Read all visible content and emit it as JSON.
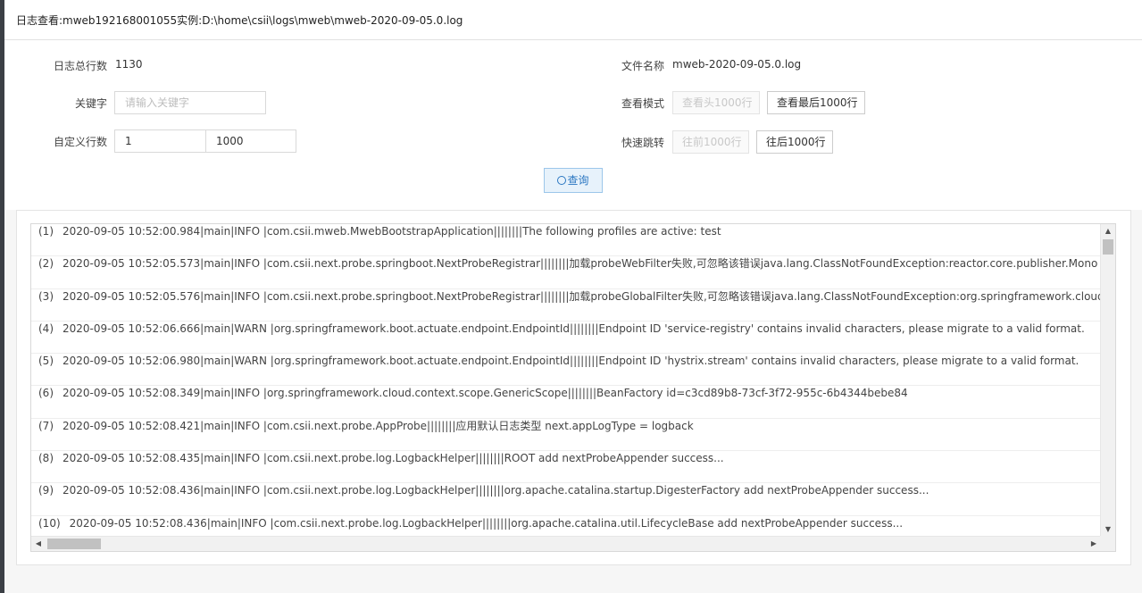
{
  "window": {
    "title": "日志查看:mweb192168001055实例:D:\\home\\csii\\logs\\mweb\\mweb-2020-09-05.0.log"
  },
  "form": {
    "total_lines_label": "日志总行数",
    "total_lines_value": "1130",
    "file_name_label": "文件名称",
    "file_name_value": "mweb-2020-09-05.0.log",
    "keyword_label": "关键字",
    "keyword_placeholder": "请输入关键字",
    "view_mode_label": "查看模式",
    "view_head_button": "查看头1000行",
    "view_tail_button": "查看最后1000行",
    "custom_lines_label": "自定义行数",
    "custom_start_value": "1",
    "custom_end_value": "1000",
    "quick_jump_label": "快速跳转",
    "prev_button": "往前1000行",
    "next_button": "往后1000行",
    "query_button": "查询",
    "query_icon": "search-icon"
  },
  "log": {
    "rows": [
      {
        "num": "(1)",
        "text": "2020-09-05 10:52:00.984|main|INFO |com.csii.mweb.MwebBootstrapApplication||||||||The following profiles are active: test"
      },
      {
        "num": "(2)",
        "text": "2020-09-05 10:52:05.573|main|INFO |com.csii.next.probe.springboot.NextProbeRegistrar||||||||加载probeWebFilter失败,可忽略该错误java.lang.ClassNotFoundException:reactor.core.publisher.Mono"
      },
      {
        "num": "(3)",
        "text": "2020-09-05 10:52:05.576|main|INFO |com.csii.next.probe.springboot.NextProbeRegistrar||||||||加载probeGlobalFilter失败,可忽略该错误java.lang.ClassNotFoundException:org.springframework.cloud.gateway.filter.GlobalF"
      },
      {
        "num": "(4)",
        "text": "2020-09-05 10:52:06.666|main|WARN |org.springframework.boot.actuate.endpoint.EndpointId||||||||Endpoint ID 'service-registry' contains invalid characters, please migrate to a valid format."
      },
      {
        "num": "(5)",
        "text": "2020-09-05 10:52:06.980|main|WARN |org.springframework.boot.actuate.endpoint.EndpointId||||||||Endpoint ID 'hystrix.stream' contains invalid characters, please migrate to a valid format."
      },
      {
        "num": "(6)",
        "text": "2020-09-05 10:52:08.349|main|INFO |org.springframework.cloud.context.scope.GenericScope||||||||BeanFactory id=c3cd89b8-73cf-3f72-955c-6b4344bebe84"
      },
      {
        "num": "(7)",
        "text": "2020-09-05 10:52:08.421|main|INFO |com.csii.next.probe.AppProbe||||||||应用默认日志类型 next.appLogType = logback"
      },
      {
        "num": "(8)",
        "text": "2020-09-05 10:52:08.435|main|INFO |com.csii.next.probe.log.LogbackHelper||||||||ROOT add nextProbeAppender success..."
      },
      {
        "num": "(9)",
        "text": "2020-09-05 10:52:08.436|main|INFO |com.csii.next.probe.log.LogbackHelper||||||||org.apache.catalina.startup.DigesterFactory add nextProbeAppender success..."
      },
      {
        "num": "(10)",
        "text": "2020-09-05 10:52:08.436|main|INFO |com.csii.next.probe.log.LogbackHelper||||||||org.apache.catalina.util.LifecycleBase add nextProbeAppender success..."
      }
    ]
  }
}
